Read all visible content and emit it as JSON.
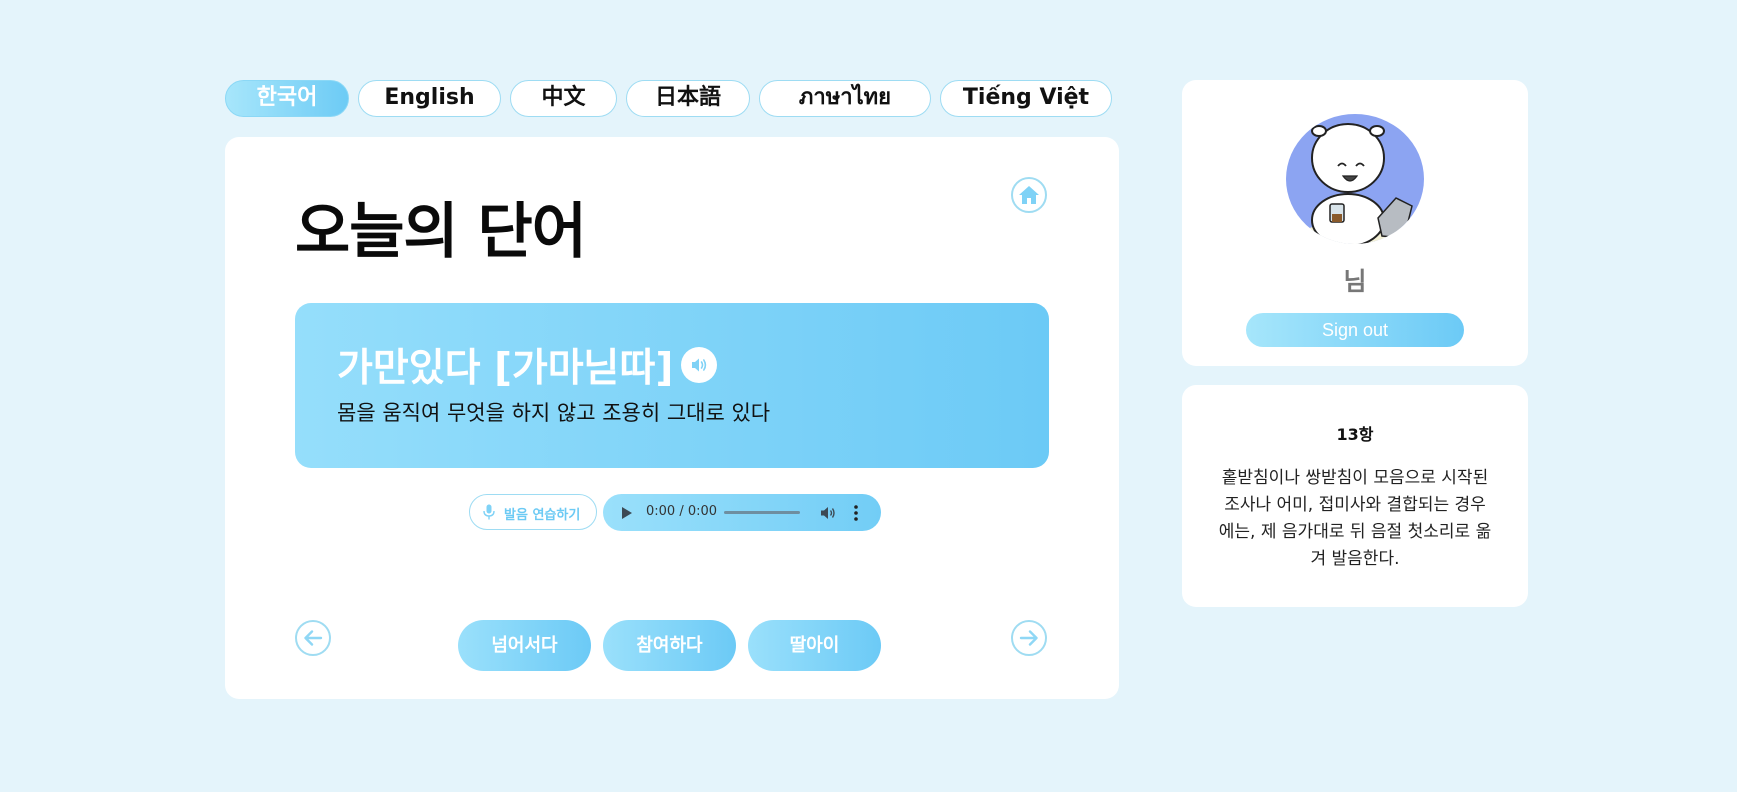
{
  "languages": [
    {
      "label": "한국어",
      "active": true
    },
    {
      "label": "English",
      "active": false
    },
    {
      "label": "中文",
      "active": false
    },
    {
      "label": "日本語",
      "active": false
    },
    {
      "label": "ภาษาไทย",
      "active": false
    },
    {
      "label": "Tiếng Việt",
      "active": false
    }
  ],
  "main": {
    "title": "오늘의 단어",
    "word": "가만있다 [가마닏따]",
    "meaning": "몸을 움직여 무엇을 하지 않고 조용히 그대로 있다",
    "practice_label": "발음 연습하기",
    "audio_time": "0:00 / 0:00",
    "related_words": [
      "넘어서다",
      "참여하다",
      "딸아이"
    ]
  },
  "profile": {
    "name": "님",
    "signout_label": "Sign out"
  },
  "rule": {
    "title": "13항",
    "body": "홑받침이나 쌍받침이 모음으로 시작된 조사나 어미, 접미사와 결합되는 경우에는, 제 음가대로 뒤 음절 첫소리로 옮겨 발음한다."
  },
  "icons": {
    "home": "home-icon",
    "prev": "arrow-left-icon",
    "next": "arrow-right-icon",
    "speaker": "speaker-icon",
    "mic": "microphone-icon",
    "play": "play-icon",
    "volume": "volume-icon",
    "more": "more-vertical-icon"
  },
  "colors": {
    "accent": "#6ccaf6",
    "accent_light": "#9ae0fb",
    "page_background": "#e4f4fb",
    "avatar_background": "#8ca4f2"
  }
}
